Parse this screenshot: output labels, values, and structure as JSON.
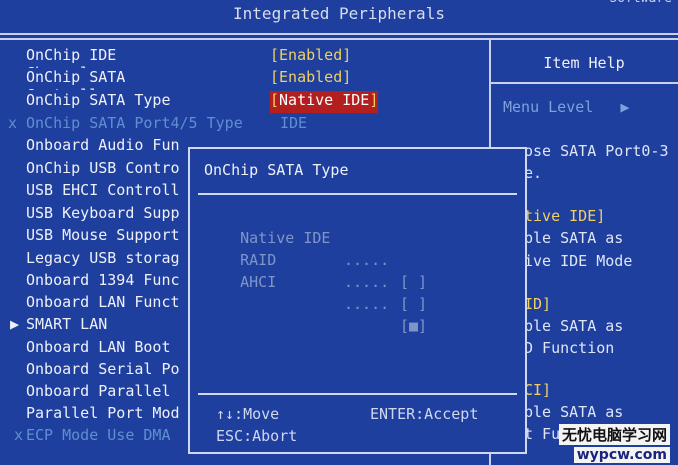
{
  "header": {
    "title": "Integrated Peripherals",
    "corner_fragment": "Software"
  },
  "settings": [
    {
      "label": "OnChip IDE Channel",
      "value": "[Enabled]",
      "marker": ""
    },
    {
      "label": "OnChip SATA Controller",
      "value": "[Enabled]",
      "marker": ""
    },
    {
      "label": "OnChip SATA Type",
      "value": "Native IDE",
      "marker": "",
      "selected": true
    },
    {
      "label": "OnChip SATA Port4/5 Type",
      "value": "IDE",
      "marker": "x",
      "disabled": true
    },
    {
      "label": "Onboard Audio Fun",
      "value": "",
      "marker": ""
    },
    {
      "label": "OnChip USB Contro",
      "value": "",
      "marker": ""
    },
    {
      "label": "USB EHCI Controll",
      "value": "",
      "marker": ""
    },
    {
      "label": "USB Keyboard Supp",
      "value": "",
      "marker": ""
    },
    {
      "label": "USB Mouse Support",
      "value": "",
      "marker": ""
    },
    {
      "label": "Legacy USB storag",
      "value": "",
      "marker": ""
    },
    {
      "label": "Onboard 1394 Func",
      "value": "",
      "marker": ""
    },
    {
      "label": "Onboard LAN Funct",
      "value": "",
      "marker": ""
    },
    {
      "label": "SMART LAN",
      "value": "",
      "marker": "▶"
    },
    {
      "label": "Onboard LAN Boot",
      "value": "",
      "marker": ""
    },
    {
      "label": "Onboard Serial Po",
      "value": "",
      "marker": ""
    },
    {
      "label": "Onboard Parallel",
      "value": "",
      "marker": ""
    },
    {
      "label": "Parallel Port Mod",
      "value": "",
      "marker": ""
    },
    {
      "label": "ECP Mode Use DMA",
      "value": "",
      "marker": "x",
      "disabled": true
    }
  ],
  "item_help": {
    "title": "Item Help",
    "menu_level": "Menu Level   ▶",
    "fragments": [
      {
        "text": "ose SATA Port0-3",
        "yellow": false
      },
      {
        "text": "e.",
        "yellow": false
      },
      {
        "text": "tive IDE]",
        "yellow": true
      },
      {
        "text": "ble SATA as",
        "yellow": false
      },
      {
        "text": "ive IDE Mode",
        "yellow": false
      },
      {
        "text": "ID]",
        "yellow": true
      },
      {
        "text": "ble SATA as",
        "yellow": false
      },
      {
        "text": "D Function",
        "yellow": false
      },
      {
        "text": "CI]",
        "yellow": true
      },
      {
        "text": "ble SATA as",
        "yellow": false
      },
      {
        "text": "t Fu",
        "yellow": false
      }
    ]
  },
  "popup": {
    "title": "OnChip SATA Type",
    "options": [
      {
        "label": "Native IDE",
        "dots": ".....",
        "box": "[ ]"
      },
      {
        "label": "RAID",
        "dots": ".....",
        "box": "[ ]"
      },
      {
        "label": "AHCI",
        "dots": ".....",
        "box": "[■]"
      }
    ],
    "footer": {
      "move": "↑↓:Move",
      "accept": "ENTER:Accept",
      "abort": "ESC:Abort"
    }
  },
  "watermark": {
    "cn": "无忧电脑学习网",
    "url": "wypcw.com"
  },
  "colors": {
    "background": "#1f3f9e",
    "value_yellow": "#f0d060",
    "highlight_red": "#b31e1e",
    "disabled_blue": "#5f8fd0"
  }
}
